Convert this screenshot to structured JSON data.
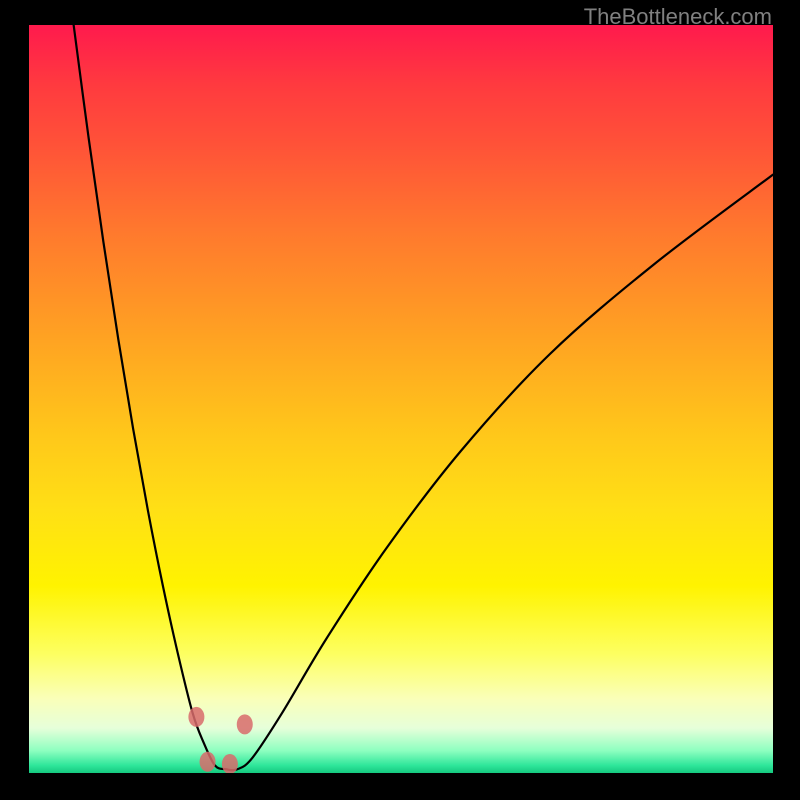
{
  "watermark": "TheBottleneck.com",
  "chart_data": {
    "type": "line",
    "title": "",
    "xlabel": "",
    "ylabel": "",
    "xlim": [
      0,
      100
    ],
    "ylim": [
      0,
      100
    ],
    "series": [
      {
        "name": "bottleneck-curve",
        "x": [
          6,
          8,
          10,
          12,
          14,
          16,
          18,
          20,
          22,
          23.5,
          25,
          26.5,
          28,
          30,
          34,
          40,
          48,
          58,
          70,
          84,
          100
        ],
        "y": [
          100,
          85,
          71,
          58,
          46,
          35,
          25,
          16,
          8,
          4,
          1,
          0.5,
          0.5,
          2,
          8,
          18,
          30,
          43,
          56,
          68,
          80
        ]
      }
    ],
    "markers": [
      {
        "x": 22.5,
        "y": 7.5
      },
      {
        "x": 24.0,
        "y": 1.5
      },
      {
        "x": 27.0,
        "y": 1.2
      },
      {
        "x": 29.0,
        "y": 6.5
      }
    ],
    "marker_color": "#d86b6b",
    "curve_color": "#000000",
    "gradient_stops": [
      {
        "pos": 0.0,
        "color": "#ff1a4d"
      },
      {
        "pos": 0.5,
        "color": "#ffc000"
      },
      {
        "pos": 0.85,
        "color": "#fff55a"
      },
      {
        "pos": 1.0,
        "color": "#15c97f"
      }
    ]
  }
}
